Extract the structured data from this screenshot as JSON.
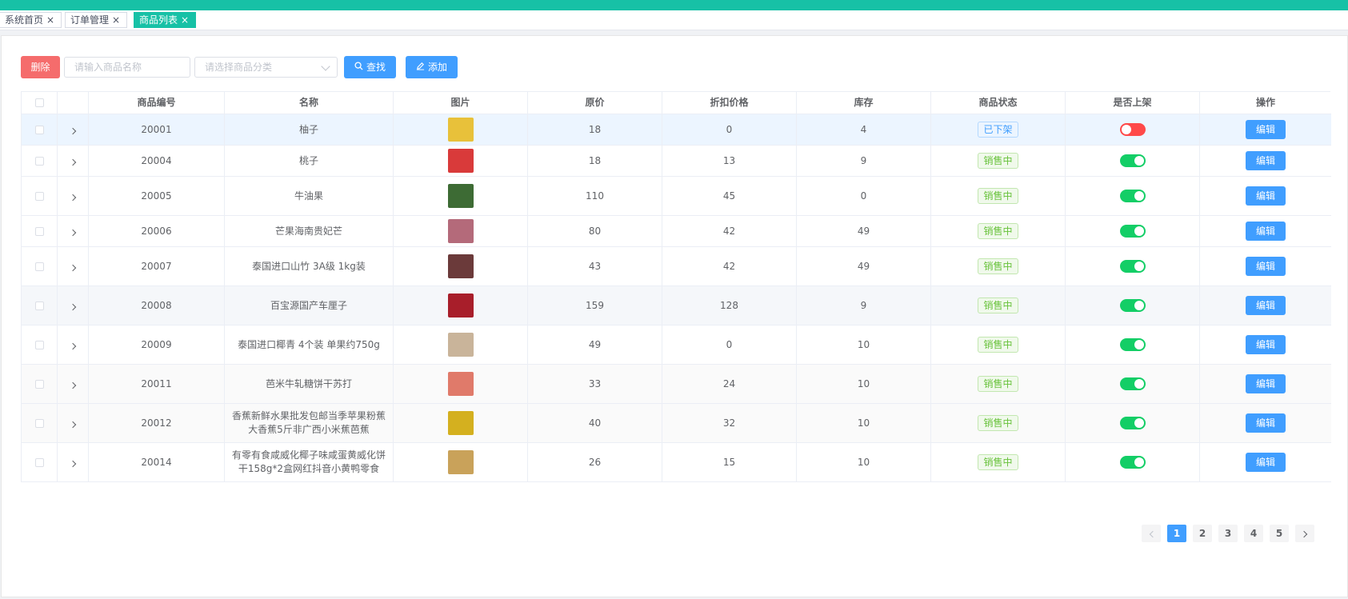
{
  "tabs": [
    {
      "label": "系统首页",
      "close": "×"
    },
    {
      "label": "订单管理",
      "close": "×"
    },
    {
      "label": "商品列表",
      "close": "×"
    }
  ],
  "toolbar": {
    "delete_label": "删除",
    "name_placeholder": "请输入商品名称",
    "category_placeholder": "请选择商品分类",
    "search_label": "查找",
    "add_label": "添加"
  },
  "table": {
    "columns": [
      "商品编号",
      "名称",
      "图片",
      "原价",
      "折扣价格",
      "库存",
      "商品状态",
      "是否上架",
      "操作"
    ],
    "rows": [
      {
        "id": "20001",
        "name": "柚子",
        "price": "18",
        "discount": "0",
        "stock": "4",
        "status": "已下架",
        "listed": false,
        "image_color": "#e8c13a"
      },
      {
        "id": "20004",
        "name": "桃子",
        "price": "18",
        "discount": "13",
        "stock": "9",
        "status": "销售中",
        "listed": true,
        "image_color": "#d93a3a"
      },
      {
        "id": "20005",
        "name": "牛油果",
        "price": "110",
        "discount": "45",
        "stock": "0",
        "status": "销售中",
        "listed": true,
        "image_color": "#3d6b34"
      },
      {
        "id": "20006",
        "name": "芒果海南贵妃芒",
        "price": "80",
        "discount": "42",
        "stock": "49",
        "status": "销售中",
        "listed": true,
        "image_color": "#b46a7a"
      },
      {
        "id": "20007",
        "name": "泰国进口山竹 3A级 1kg装",
        "price": "43",
        "discount": "42",
        "stock": "49",
        "status": "销售中",
        "listed": true,
        "image_color": "#6b3a3a"
      },
      {
        "id": "20008",
        "name": "百宝源国产车厘子",
        "price": "159",
        "discount": "128",
        "stock": "9",
        "status": "销售中",
        "listed": true,
        "image_color": "#a81e2a"
      },
      {
        "id": "20009",
        "name": "泰国进口椰青 4个装 单果约750g",
        "price": "49",
        "discount": "0",
        "stock": "10",
        "status": "销售中",
        "listed": true,
        "image_color": "#c9b49a"
      },
      {
        "id": "20011",
        "name": "芭米牛轧糖饼干苏打",
        "price": "33",
        "discount": "24",
        "stock": "10",
        "status": "销售中",
        "listed": true,
        "image_color": "#e07a6a"
      },
      {
        "id": "20012",
        "name": "香蕉新鲜水果批发包邮当季苹果粉蕉大香蕉5斤非广西小米蕉芭蕉",
        "price": "40",
        "discount": "32",
        "stock": "10",
        "status": "销售中",
        "listed": true,
        "image_color": "#d4b01f"
      },
      {
        "id": "20014",
        "name": "有零有食咸威化椰子味咸蛋黄威化饼干158g*2盒网红抖音小黄鸭零食",
        "price": "26",
        "discount": "15",
        "stock": "10",
        "status": "销售中",
        "listed": true,
        "image_color": "#c9a25a"
      }
    ],
    "edit_label": "编辑"
  },
  "pagination": {
    "pages": [
      "1",
      "2",
      "3",
      "4",
      "5"
    ],
    "current": "1"
  },
  "colors": {
    "accent": "#17c1a6",
    "primary": "#409eff",
    "danger": "#f56c6c",
    "switch_on": "#13ce66",
    "switch_off": "#ff4949"
  }
}
